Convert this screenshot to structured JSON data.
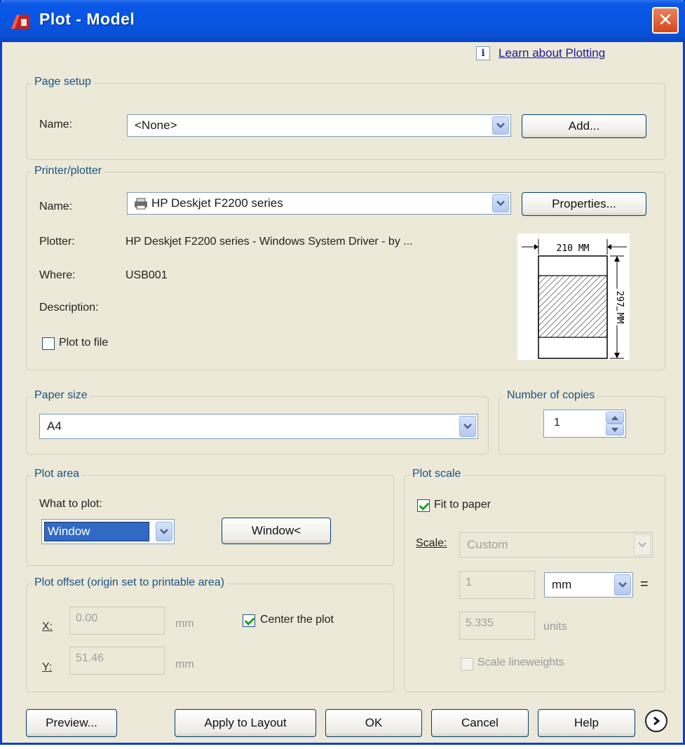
{
  "window": {
    "title": "Plot - Model",
    "close_glyph": "✕"
  },
  "help": {
    "info_glyph": "i",
    "link": "Learn about Plotting"
  },
  "page_setup": {
    "title": "Page setup",
    "name_label": "Name:",
    "name_value": "<None>",
    "add_button": "Add..."
  },
  "printer": {
    "title": "Printer/plotter",
    "name_label": "Name:",
    "name_value": "HP Deskjet F2200 series",
    "properties_button": "Properties...",
    "plotter_label": "Plotter:",
    "plotter_value": "HP Deskjet F2200 series - Windows System Driver - by ...",
    "where_label": "Where:",
    "where_value": "USB001",
    "description_label": "Description:",
    "plot_to_file_label": "Plot to file",
    "plot_to_file_checked": false,
    "preview_width_text": "210 MM",
    "preview_height_text": "297 MM"
  },
  "paper_size": {
    "title": "Paper size",
    "value": "A4"
  },
  "copies": {
    "title": "Number of copies",
    "value": "1"
  },
  "plot_area": {
    "title": "Plot area",
    "what_label": "What to plot:",
    "what_value": "Window",
    "window_button": "Window<"
  },
  "plot_scale": {
    "title": "Plot scale",
    "fit_label": "Fit to paper",
    "fit_checked": true,
    "scale_label": "Scale:",
    "scale_value": "Custom",
    "numerator": "1",
    "unit_value": "mm",
    "equals": "=",
    "denominator": "5.335",
    "units_label": "units",
    "lineweights_label": "Scale lineweights"
  },
  "plot_offset": {
    "title": "Plot offset (origin set to printable area)",
    "x_label": "X:",
    "x_value": "0.00",
    "x_unit": "mm",
    "y_label": "Y:",
    "y_value": "51.46",
    "y_unit": "mm",
    "center_label": "Center the plot",
    "center_checked": true
  },
  "buttons": {
    "preview": "Preview...",
    "apply": "Apply to Layout",
    "ok": "OK",
    "cancel": "Cancel",
    "help": "Help"
  },
  "colors": {
    "title_bar": "#0656e2",
    "group_title": "#1c5180",
    "selection": "#316ac5",
    "face": "#ece9d8"
  }
}
